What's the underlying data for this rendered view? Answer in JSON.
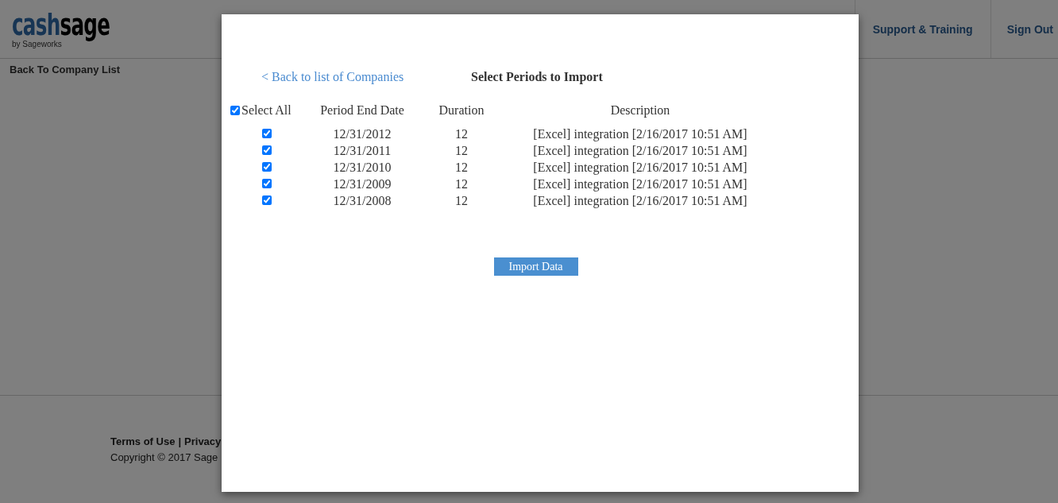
{
  "header": {
    "logo": {
      "primary": "cash",
      "secondary": "sage",
      "tagline": "by Sageworks"
    },
    "nav": [
      "Support & Training",
      "Sign Out"
    ]
  },
  "back_link": "Back To Company List",
  "footer": {
    "links": [
      "Terms of Use",
      "Privacy"
    ],
    "separator": "|",
    "copyright": "Copyright © 2017 Sage"
  },
  "dialog": {
    "back_link": "< Back to list of Companies",
    "title": "Select Periods to Import",
    "select_all": {
      "label": "Select All",
      "checked": true
    },
    "columns": [
      "Period End Date",
      "Duration",
      "Description"
    ],
    "rows": [
      {
        "checked": true,
        "date": "12/31/2012",
        "duration": "12",
        "description": "[Excel] integration [2/16/2017 10:51 AM]"
      },
      {
        "checked": true,
        "date": "12/31/2011",
        "duration": "12",
        "description": "[Excel] integration [2/16/2017 10:51 AM]"
      },
      {
        "checked": true,
        "date": "12/31/2010",
        "duration": "12",
        "description": "[Excel] integration [2/16/2017 10:51 AM]"
      },
      {
        "checked": true,
        "date": "12/31/2009",
        "duration": "12",
        "description": "[Excel] integration [2/16/2017 10:51 AM]"
      },
      {
        "checked": true,
        "date": "12/31/2008",
        "duration": "12",
        "description": "[Excel] integration [2/16/2017 10:51 AM]"
      }
    ],
    "button": "Import Data"
  }
}
